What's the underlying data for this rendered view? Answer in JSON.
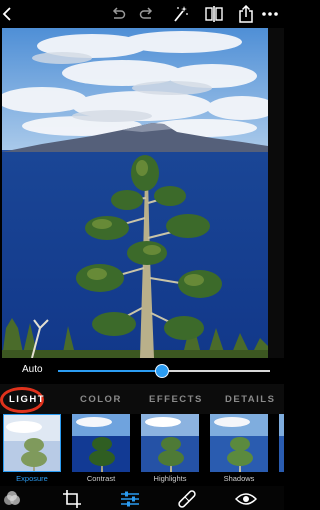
{
  "toolbar": {
    "icons": [
      "chevron-left-icon",
      "undo-icon",
      "redo-icon",
      "magic-wand-icon",
      "compare-icon",
      "share-icon",
      "more-icon"
    ]
  },
  "slider": {
    "label": "Auto",
    "value": 0.49
  },
  "tabs": [
    {
      "label": "LIGHT",
      "active": true
    },
    {
      "label": "COLOR",
      "active": false
    },
    {
      "label": "EFFECTS",
      "active": false
    },
    {
      "label": "DETAILS",
      "active": false
    }
  ],
  "presets": [
    {
      "label": "Exposure",
      "selected": true
    },
    {
      "label": "Contrast",
      "selected": false
    },
    {
      "label": "Highlights",
      "selected": false
    },
    {
      "label": "Shadows",
      "selected": false
    }
  ],
  "bottom_bar": {
    "icons": [
      "looks-icon",
      "crop-icon",
      "adjustments-icon",
      "healing-icon",
      "eye-icon"
    ]
  },
  "colors": {
    "accent": "#2b9cf2",
    "highlight_ring": "#e0321c"
  }
}
